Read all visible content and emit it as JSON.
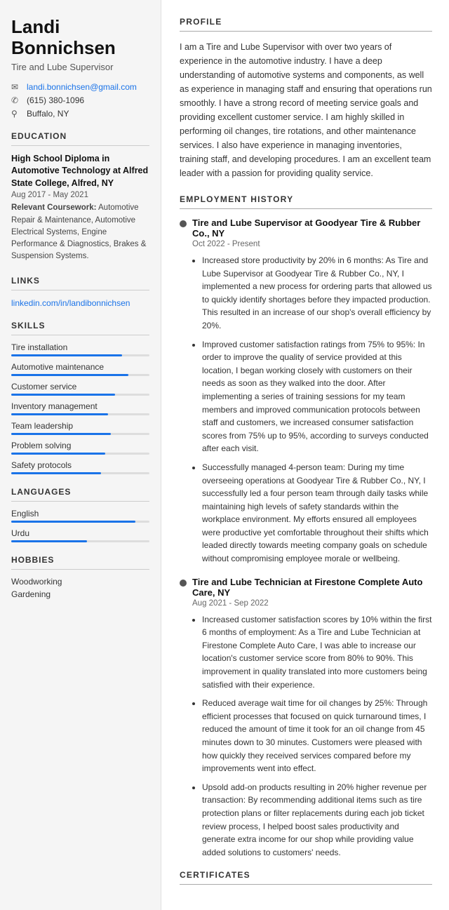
{
  "sidebar": {
    "name_line1": "Landi",
    "name_line2": "Bonnichsen",
    "job_title": "Tire and Lube Supervisor",
    "contact": {
      "email": "landi.bonnichsen@gmail.com",
      "phone": "(615) 380-1096",
      "location": "Buffalo, NY"
    },
    "education_label": "Education",
    "education": {
      "degree": "High School Diploma in Automotive Technology at Alfred State College, Alfred, NY",
      "dates": "Aug 2017 - May 2021",
      "coursework_label": "Relevant Coursework:",
      "coursework": "Automotive Repair & Maintenance, Automotive Electrical Systems, Engine Performance & Diagnostics, Brakes & Suspension Systems."
    },
    "links_label": "Links",
    "links": [
      {
        "text": "linkedin.com/in/landibonnichsen",
        "url": "#"
      }
    ],
    "skills_label": "Skills",
    "skills": [
      {
        "name": "Tire installation",
        "pct": 80
      },
      {
        "name": "Automotive maintenance",
        "pct": 85
      },
      {
        "name": "Customer service",
        "pct": 75
      },
      {
        "name": "Inventory management",
        "pct": 70
      },
      {
        "name": "Team leadership",
        "pct": 72
      },
      {
        "name": "Problem solving",
        "pct": 68
      },
      {
        "name": "Safety protocols",
        "pct": 65
      }
    ],
    "languages_label": "Languages",
    "languages": [
      {
        "name": "English",
        "pct": 90
      },
      {
        "name": "Urdu",
        "pct": 55
      }
    ],
    "hobbies_label": "Hobbies",
    "hobbies": [
      "Woodworking",
      "Gardening"
    ]
  },
  "main": {
    "profile_label": "Profile",
    "profile_text": "I am a Tire and Lube Supervisor with over two years of experience in the automotive industry. I have a deep understanding of automotive systems and components, as well as experience in managing staff and ensuring that operations run smoothly. I have a strong record of meeting service goals and providing excellent customer service. I am highly skilled in performing oil changes, tire rotations, and other maintenance services. I also have experience in managing inventories, training staff, and developing procedures. I am an excellent team leader with a passion for providing quality service.",
    "employment_label": "Employment History",
    "jobs": [
      {
        "title": "Tire and Lube Supervisor at Goodyear Tire & Rubber Co., NY",
        "dates": "Oct 2022 - Present",
        "bullets": [
          "Increased store productivity by 20% in 6 months: As Tire and Lube Supervisor at Goodyear Tire & Rubber Co., NY, I implemented a new process for ordering parts that allowed us to quickly identify shortages before they impacted production. This resulted in an increase of our shop's overall efficiency by 20%.",
          "Improved customer satisfaction ratings from 75% to 95%: In order to improve the quality of service provided at this location, I began working closely with customers on their needs as soon as they walked into the door. After implementing a series of training sessions for my team members and improved communication protocols between staff and customers, we increased consumer satisfaction scores from 75% up to 95%, according to surveys conducted after each visit.",
          "Successfully managed 4-person team: During my time overseeing operations at Goodyear Tire & Rubber Co., NY, I successfully led a four person team through daily tasks while maintaining high levels of safety standards within the workplace environment. My efforts ensured all employees were productive yet comfortable throughout their shifts which leaded directly towards meeting company goals on schedule without compromising employee morale or wellbeing."
        ]
      },
      {
        "title": "Tire and Lube Technician at Firestone Complete Auto Care, NY",
        "dates": "Aug 2021 - Sep 2022",
        "bullets": [
          "Increased customer satisfaction scores by 10% within the first 6 months of employment: As a Tire and Lube Technician at Firestone Complete Auto Care, I was able to increase our location's customer service score from 80% to 90%. This improvement in quality translated into more customers being satisfied with their experience.",
          "Reduced average wait time for oil changes by 25%: Through efficient processes that focused on quick turnaround times, I reduced the amount of time it took for an oil change from 45 minutes down to 30 minutes. Customers were pleased with how quickly they received services compared before my improvements went into effect.",
          "Upsold add-on products resulting in 20% higher revenue per transaction: By recommending additional items such as tire protection plans or filter replacements during each job ticket review process, I helped boost sales productivity and generate extra income for our shop while providing value added solutions to customers' needs."
        ]
      }
    ],
    "certificates_label": "Certificates"
  }
}
